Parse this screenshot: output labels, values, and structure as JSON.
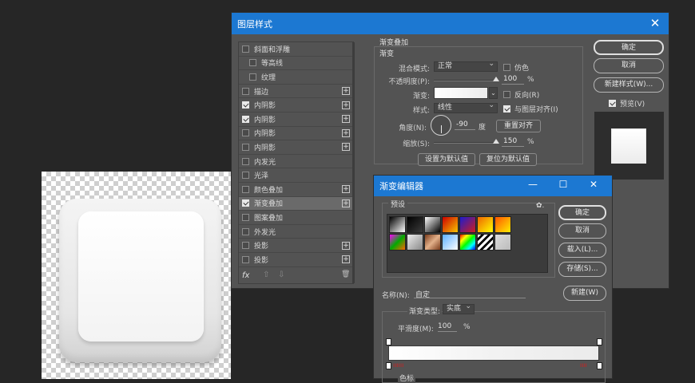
{
  "layer_style": {
    "title": "图层样式",
    "styles": [
      {
        "label": "斜面和浮雕",
        "checked": false,
        "plus": false,
        "indent": false
      },
      {
        "label": "等高线",
        "checked": false,
        "plus": false,
        "indent": true
      },
      {
        "label": "纹理",
        "checked": false,
        "plus": false,
        "indent": true
      },
      {
        "label": "描边",
        "checked": false,
        "plus": true,
        "indent": false
      },
      {
        "label": "内阴影",
        "checked": true,
        "plus": true,
        "indent": false
      },
      {
        "label": "内阴影",
        "checked": true,
        "plus": true,
        "indent": false
      },
      {
        "label": "内阴影",
        "checked": false,
        "plus": true,
        "indent": false
      },
      {
        "label": "内阴影",
        "checked": false,
        "plus": true,
        "indent": false
      },
      {
        "label": "内发光",
        "checked": false,
        "plus": false,
        "indent": false
      },
      {
        "label": "光泽",
        "checked": false,
        "plus": false,
        "indent": false
      },
      {
        "label": "颜色叠加",
        "checked": false,
        "plus": true,
        "indent": false
      },
      {
        "label": "渐变叠加",
        "checked": true,
        "plus": true,
        "indent": false,
        "active": true
      },
      {
        "label": "图案叠加",
        "checked": false,
        "plus": false,
        "indent": false
      },
      {
        "label": "外发光",
        "checked": false,
        "plus": false,
        "indent": false
      },
      {
        "label": "投影",
        "checked": false,
        "plus": true,
        "indent": false
      },
      {
        "label": "投影",
        "checked": false,
        "plus": true,
        "indent": false
      }
    ],
    "footer": {
      "fx": "fx",
      "up": "⇧",
      "down": "⇩",
      "trash": "🗑"
    },
    "gradient_overlay": {
      "group_title": "渐变叠加",
      "sub_title": "渐变",
      "blend_label": "混合模式:",
      "blend_value": "正常",
      "dither_label": "仿色",
      "opacity_label": "不透明度(P):",
      "opacity_value": "100",
      "opacity_unit": "%",
      "opacity_level": 1.0,
      "gradient_label": "渐变:",
      "reverse_label": "反向(R)",
      "style_label": "样式:",
      "style_value": "线性",
      "align_label": "与图层对齐(I)",
      "align_checked": true,
      "angle_label": "角度(N):",
      "angle_value": "-90",
      "angle_unit": "度",
      "reset_align": "重置对齐",
      "scale_label": "缩放(S):",
      "scale_value": "150",
      "scale_unit": "%",
      "scale_level": 1.0,
      "set_default": "设置为默认值",
      "reset_default": "复位为默认值"
    },
    "buttons": {
      "ok": "确定",
      "cancel": "取消",
      "new_style": "新建样式(W)...",
      "preview": "预览(V)"
    },
    "preview_checked": true
  },
  "gradient_editor": {
    "title": "渐变编辑器",
    "presets_label": "预设",
    "gear": "✿.",
    "buttons": {
      "ok": "确定",
      "cancel": "取消",
      "load": "载入(L)...",
      "save": "存储(S)...",
      "new": "新建(W)"
    },
    "name_label": "名称(N):",
    "name_value": "自定",
    "type_label": "渐变类型:",
    "type_value": "实底",
    "smooth_label": "平滑度(M):",
    "smooth_value": "100",
    "smooth_unit": "%",
    "stops_label": "色标",
    "controls": {
      "minimize": "—",
      "maximize": "☐",
      "close": "✕"
    },
    "swatch_colors": [
      [
        "#000000",
        "#000000",
        "#ffffff",
        "#d21818",
        "#2a2ad8",
        "#d8c800",
        "#e6a000"
      ],
      [
        "#6a1cc0",
        "#ffffff",
        "#b26a3a",
        "#3aa0ff",
        "#1c9a9a",
        "#aaaaaa",
        "#cccccc"
      ]
    ]
  },
  "close_glyph": "✕"
}
